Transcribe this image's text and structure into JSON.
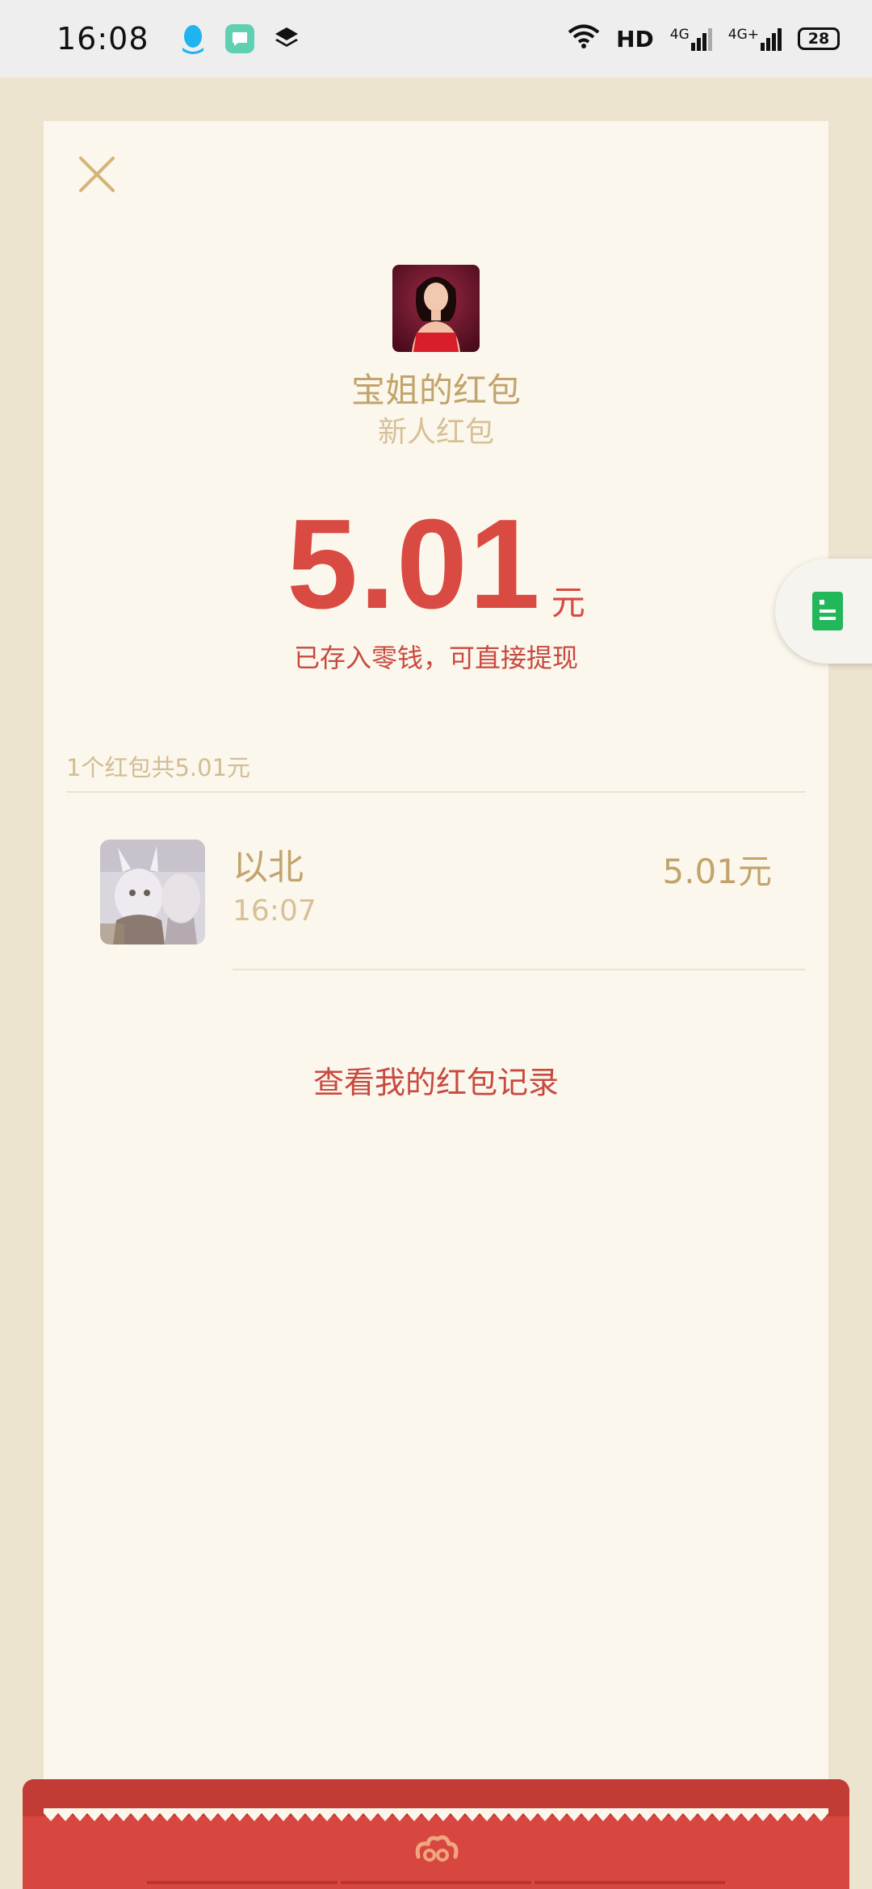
{
  "status_bar": {
    "time": "16:08",
    "network_hd": "HD",
    "signal_1": "4G",
    "signal_2": "4G+",
    "battery": "28",
    "icons": [
      "qq-icon",
      "message-app-icon",
      "layers-app-icon",
      "wifi-icon",
      "signal-icon",
      "battery-icon"
    ]
  },
  "card": {
    "close_icon": "close-icon",
    "sender_title": "宝姐的红包",
    "sender_subtitle": "新人红包",
    "amount": "5.01",
    "amount_unit": "元",
    "stored_note": "已存入零钱，可直接提现",
    "summary": "1个红包共5.01元",
    "records": [
      {
        "name": "以北",
        "time": "16:07",
        "amount": "5.01元"
      }
    ],
    "history_link": "查看我的红包记录"
  },
  "colors": {
    "background": "#ede4d0",
    "card": "#fbf7ec",
    "gold_text": "#c2a36b",
    "red_accent": "#d94a42",
    "band_red": "#d8473f",
    "float_green": "#22b85a"
  },
  "float_button": {
    "icon": "document-icon"
  },
  "bottom_band": {
    "logo_icon": "cloud-logo-icon"
  }
}
